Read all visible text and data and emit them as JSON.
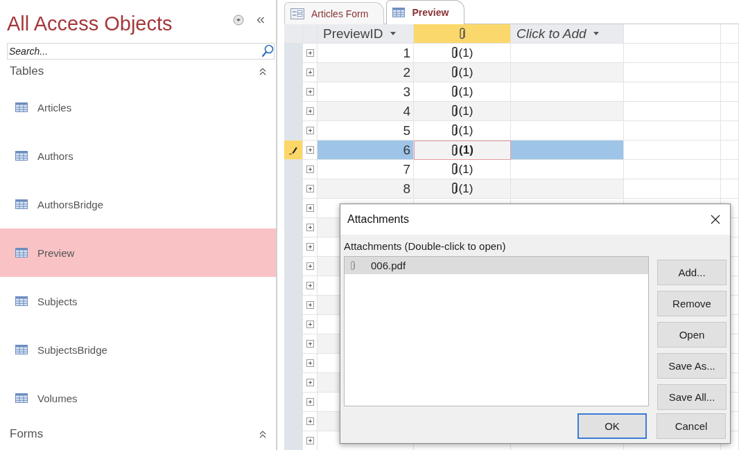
{
  "navigation": {
    "title": "All Access Objects",
    "search": {
      "placeholder": "Search..."
    },
    "groups": [
      {
        "label": "Tables",
        "expanded": true,
        "items": [
          {
            "label": "Articles",
            "selected": false
          },
          {
            "label": "Authors",
            "selected": false
          },
          {
            "label": "AuthorsBridge",
            "selected": false
          },
          {
            "label": "Preview",
            "selected": true
          },
          {
            "label": "Subjects",
            "selected": false
          },
          {
            "label": "SubjectsBridge",
            "selected": false
          },
          {
            "label": "Volumes",
            "selected": false
          }
        ]
      },
      {
        "label": "Forms",
        "expanded": true
      }
    ]
  },
  "tabs": [
    {
      "label": "Articles Form",
      "kind": "form",
      "selected": false
    },
    {
      "label": "Preview",
      "kind": "table",
      "selected": true
    }
  ],
  "datasheet": {
    "columns": [
      {
        "label": "PreviewID",
        "kind": "field",
        "selected": false
      },
      {
        "kind": "attachment",
        "selected": true
      },
      {
        "label": "Click to Add",
        "kind": "add",
        "selected": false
      }
    ],
    "rows": [
      {
        "id": "1",
        "attachment": "(1)",
        "selected": false,
        "editing": false
      },
      {
        "id": "2",
        "attachment": "(1)",
        "selected": false,
        "editing": false
      },
      {
        "id": "3",
        "attachment": "(1)",
        "selected": false,
        "editing": false
      },
      {
        "id": "4",
        "attachment": "(1)",
        "selected": false,
        "editing": false
      },
      {
        "id": "5",
        "attachment": "(1)",
        "selected": false,
        "editing": false
      },
      {
        "id": "6",
        "attachment": "(1)",
        "selected": true,
        "editing": true
      },
      {
        "id": "7",
        "attachment": "(1)",
        "selected": false,
        "editing": false
      },
      {
        "id": "8",
        "attachment": "(1)",
        "selected": false,
        "editing": false
      }
    ]
  },
  "dialog": {
    "title": "Attachments",
    "label": "Attachments (Double-click to open)",
    "files": [
      {
        "name": "006.pdf",
        "selected": true
      }
    ],
    "side_buttons": [
      "Add...",
      "Remove",
      "Open",
      "Save As...",
      "Save All..."
    ],
    "footer_buttons": [
      {
        "label": "OK",
        "default": true
      },
      {
        "label": "Cancel",
        "default": false
      }
    ]
  }
}
